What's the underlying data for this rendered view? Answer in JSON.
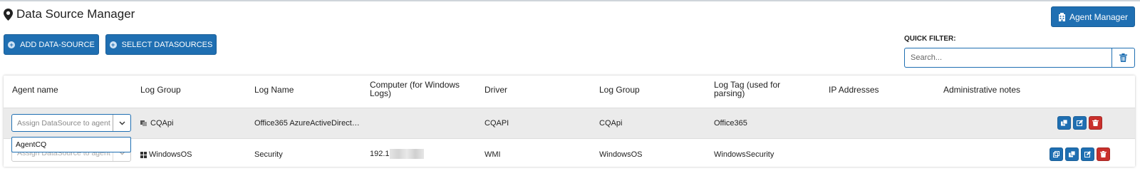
{
  "header": {
    "title": "Data Source Manager",
    "agent_manager_label": "Agent Manager"
  },
  "toolbar": {
    "add_datasource_label": "ADD DATA-SOURCE",
    "select_datasources_label": "SELECT DATASOURCES"
  },
  "quick_filter": {
    "label": "QUICK FILTER:",
    "placeholder": "Search..."
  },
  "table": {
    "columns": [
      "Agent name",
      "Log Group",
      "Log Name",
      "Computer (for Windows Logs)",
      "Driver",
      "Log Group",
      "Log Tag (used for parsing)",
      "IP Addresses",
      "Administrative notes"
    ],
    "rows": [
      {
        "agent_placeholder": "Assign DataSource to agent",
        "log_group": "CQApi",
        "log_name": "Office365 AzureActiveDirect…",
        "computer": "",
        "driver": "CQAPI",
        "log_group2": "CQApi",
        "log_tag": "Office365",
        "ip": "",
        "notes": ""
      },
      {
        "agent_placeholder": "Assign DataSource to agent",
        "log_group": "WindowsOS",
        "log_name": "Security",
        "computer": "192.1",
        "driver": "WMI",
        "log_group2": "WindowsOS",
        "log_tag": "WindowsSecurity",
        "ip": "",
        "notes": ""
      }
    ],
    "dropdown_option": "AgentCQ"
  },
  "icons": {
    "title": "map-marker-icon",
    "agent_manager": "building-icon",
    "clear": "trash-icon",
    "actions": [
      "clone-icon",
      "copy-icon",
      "edit-icon",
      "delete-icon"
    ]
  },
  "colors": {
    "primary": "#1f6fb2",
    "danger": "#c9302c",
    "selected_row": "#ebebeb"
  }
}
